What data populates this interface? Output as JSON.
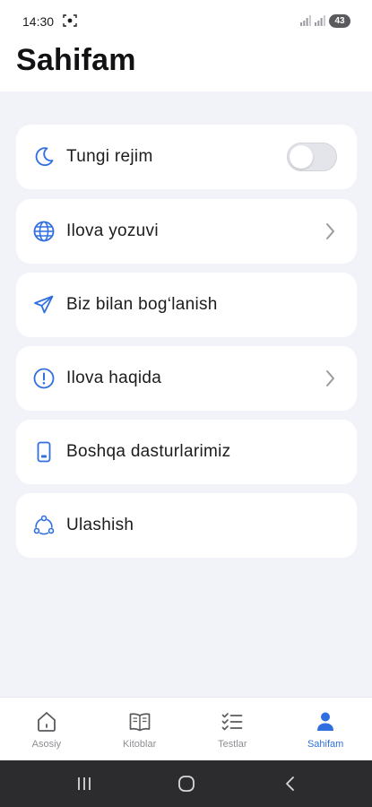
{
  "status_bar": {
    "time": "14:30",
    "battery": "43"
  },
  "page": {
    "title": "Sahifam"
  },
  "menu": {
    "items": [
      {
        "label": "Tungi rejim",
        "icon": "moon-icon",
        "control": "toggle",
        "toggle_on": false
      },
      {
        "label": "Ilova yozuvi",
        "icon": "globe-icon",
        "control": "chevron"
      },
      {
        "label": "Biz bilan bog‘lanish",
        "icon": "send-icon",
        "control": "none"
      },
      {
        "label": "Ilova haqida",
        "icon": "info-icon",
        "control": "chevron"
      },
      {
        "label": "Boshqa dasturlarimiz",
        "icon": "phone-icon",
        "control": "none"
      },
      {
        "label": "Ulashish",
        "icon": "share-icon",
        "control": "none"
      }
    ]
  },
  "bottom_nav": {
    "active": "Sahifam",
    "items": [
      {
        "label": "Asosiy",
        "icon": "home-icon"
      },
      {
        "label": "Kitoblar",
        "icon": "book-icon"
      },
      {
        "label": "Testlar",
        "icon": "checklist-icon"
      },
      {
        "label": "Sahifam",
        "icon": "user-icon"
      }
    ]
  },
  "colors": {
    "accent": "#2f6fe0",
    "background": "#f1f3f8",
    "card": "#ffffff",
    "inactive": "#8e8e93"
  }
}
